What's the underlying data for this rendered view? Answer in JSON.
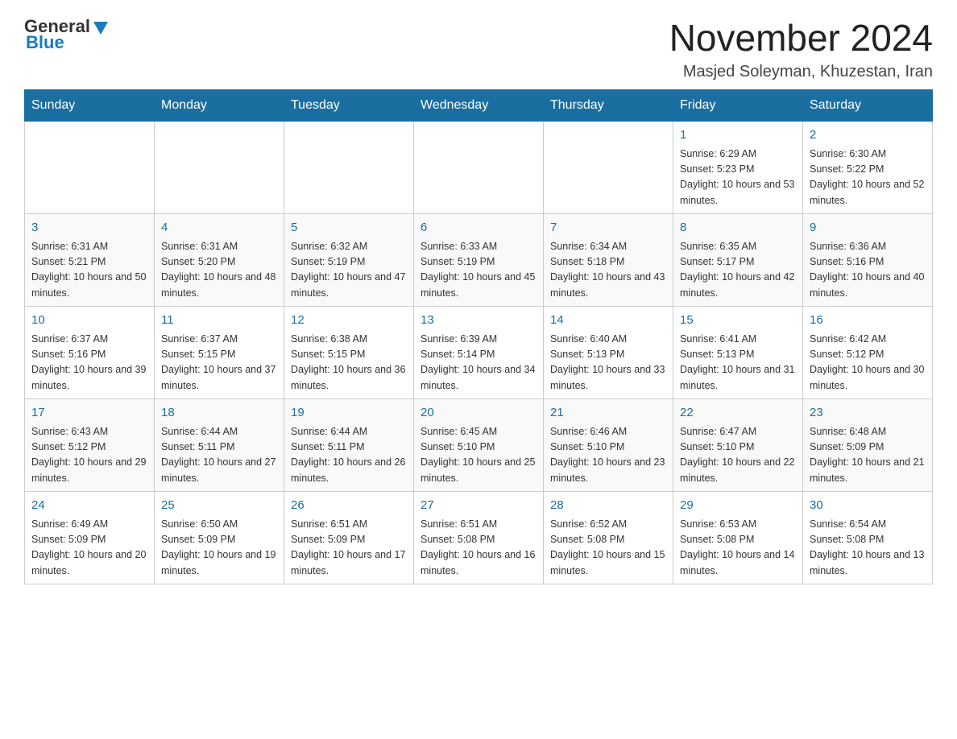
{
  "header": {
    "logo_general": "General",
    "logo_blue": "Blue",
    "month_title": "November 2024",
    "location": "Masjed Soleyman, Khuzestan, Iran"
  },
  "weekdays": [
    "Sunday",
    "Monday",
    "Tuesday",
    "Wednesday",
    "Thursday",
    "Friday",
    "Saturday"
  ],
  "weeks": [
    [
      {
        "day": "",
        "info": ""
      },
      {
        "day": "",
        "info": ""
      },
      {
        "day": "",
        "info": ""
      },
      {
        "day": "",
        "info": ""
      },
      {
        "day": "",
        "info": ""
      },
      {
        "day": "1",
        "info": "Sunrise: 6:29 AM\nSunset: 5:23 PM\nDaylight: 10 hours and 53 minutes."
      },
      {
        "day": "2",
        "info": "Sunrise: 6:30 AM\nSunset: 5:22 PM\nDaylight: 10 hours and 52 minutes."
      }
    ],
    [
      {
        "day": "3",
        "info": "Sunrise: 6:31 AM\nSunset: 5:21 PM\nDaylight: 10 hours and 50 minutes."
      },
      {
        "day": "4",
        "info": "Sunrise: 6:31 AM\nSunset: 5:20 PM\nDaylight: 10 hours and 48 minutes."
      },
      {
        "day": "5",
        "info": "Sunrise: 6:32 AM\nSunset: 5:19 PM\nDaylight: 10 hours and 47 minutes."
      },
      {
        "day": "6",
        "info": "Sunrise: 6:33 AM\nSunset: 5:19 PM\nDaylight: 10 hours and 45 minutes."
      },
      {
        "day": "7",
        "info": "Sunrise: 6:34 AM\nSunset: 5:18 PM\nDaylight: 10 hours and 43 minutes."
      },
      {
        "day": "8",
        "info": "Sunrise: 6:35 AM\nSunset: 5:17 PM\nDaylight: 10 hours and 42 minutes."
      },
      {
        "day": "9",
        "info": "Sunrise: 6:36 AM\nSunset: 5:16 PM\nDaylight: 10 hours and 40 minutes."
      }
    ],
    [
      {
        "day": "10",
        "info": "Sunrise: 6:37 AM\nSunset: 5:16 PM\nDaylight: 10 hours and 39 minutes."
      },
      {
        "day": "11",
        "info": "Sunrise: 6:37 AM\nSunset: 5:15 PM\nDaylight: 10 hours and 37 minutes."
      },
      {
        "day": "12",
        "info": "Sunrise: 6:38 AM\nSunset: 5:15 PM\nDaylight: 10 hours and 36 minutes."
      },
      {
        "day": "13",
        "info": "Sunrise: 6:39 AM\nSunset: 5:14 PM\nDaylight: 10 hours and 34 minutes."
      },
      {
        "day": "14",
        "info": "Sunrise: 6:40 AM\nSunset: 5:13 PM\nDaylight: 10 hours and 33 minutes."
      },
      {
        "day": "15",
        "info": "Sunrise: 6:41 AM\nSunset: 5:13 PM\nDaylight: 10 hours and 31 minutes."
      },
      {
        "day": "16",
        "info": "Sunrise: 6:42 AM\nSunset: 5:12 PM\nDaylight: 10 hours and 30 minutes."
      }
    ],
    [
      {
        "day": "17",
        "info": "Sunrise: 6:43 AM\nSunset: 5:12 PM\nDaylight: 10 hours and 29 minutes."
      },
      {
        "day": "18",
        "info": "Sunrise: 6:44 AM\nSunset: 5:11 PM\nDaylight: 10 hours and 27 minutes."
      },
      {
        "day": "19",
        "info": "Sunrise: 6:44 AM\nSunset: 5:11 PM\nDaylight: 10 hours and 26 minutes."
      },
      {
        "day": "20",
        "info": "Sunrise: 6:45 AM\nSunset: 5:10 PM\nDaylight: 10 hours and 25 minutes."
      },
      {
        "day": "21",
        "info": "Sunrise: 6:46 AM\nSunset: 5:10 PM\nDaylight: 10 hours and 23 minutes."
      },
      {
        "day": "22",
        "info": "Sunrise: 6:47 AM\nSunset: 5:10 PM\nDaylight: 10 hours and 22 minutes."
      },
      {
        "day": "23",
        "info": "Sunrise: 6:48 AM\nSunset: 5:09 PM\nDaylight: 10 hours and 21 minutes."
      }
    ],
    [
      {
        "day": "24",
        "info": "Sunrise: 6:49 AM\nSunset: 5:09 PM\nDaylight: 10 hours and 20 minutes."
      },
      {
        "day": "25",
        "info": "Sunrise: 6:50 AM\nSunset: 5:09 PM\nDaylight: 10 hours and 19 minutes."
      },
      {
        "day": "26",
        "info": "Sunrise: 6:51 AM\nSunset: 5:09 PM\nDaylight: 10 hours and 17 minutes."
      },
      {
        "day": "27",
        "info": "Sunrise: 6:51 AM\nSunset: 5:08 PM\nDaylight: 10 hours and 16 minutes."
      },
      {
        "day": "28",
        "info": "Sunrise: 6:52 AM\nSunset: 5:08 PM\nDaylight: 10 hours and 15 minutes."
      },
      {
        "day": "29",
        "info": "Sunrise: 6:53 AM\nSunset: 5:08 PM\nDaylight: 10 hours and 14 minutes."
      },
      {
        "day": "30",
        "info": "Sunrise: 6:54 AM\nSunset: 5:08 PM\nDaylight: 10 hours and 13 minutes."
      }
    ]
  ]
}
